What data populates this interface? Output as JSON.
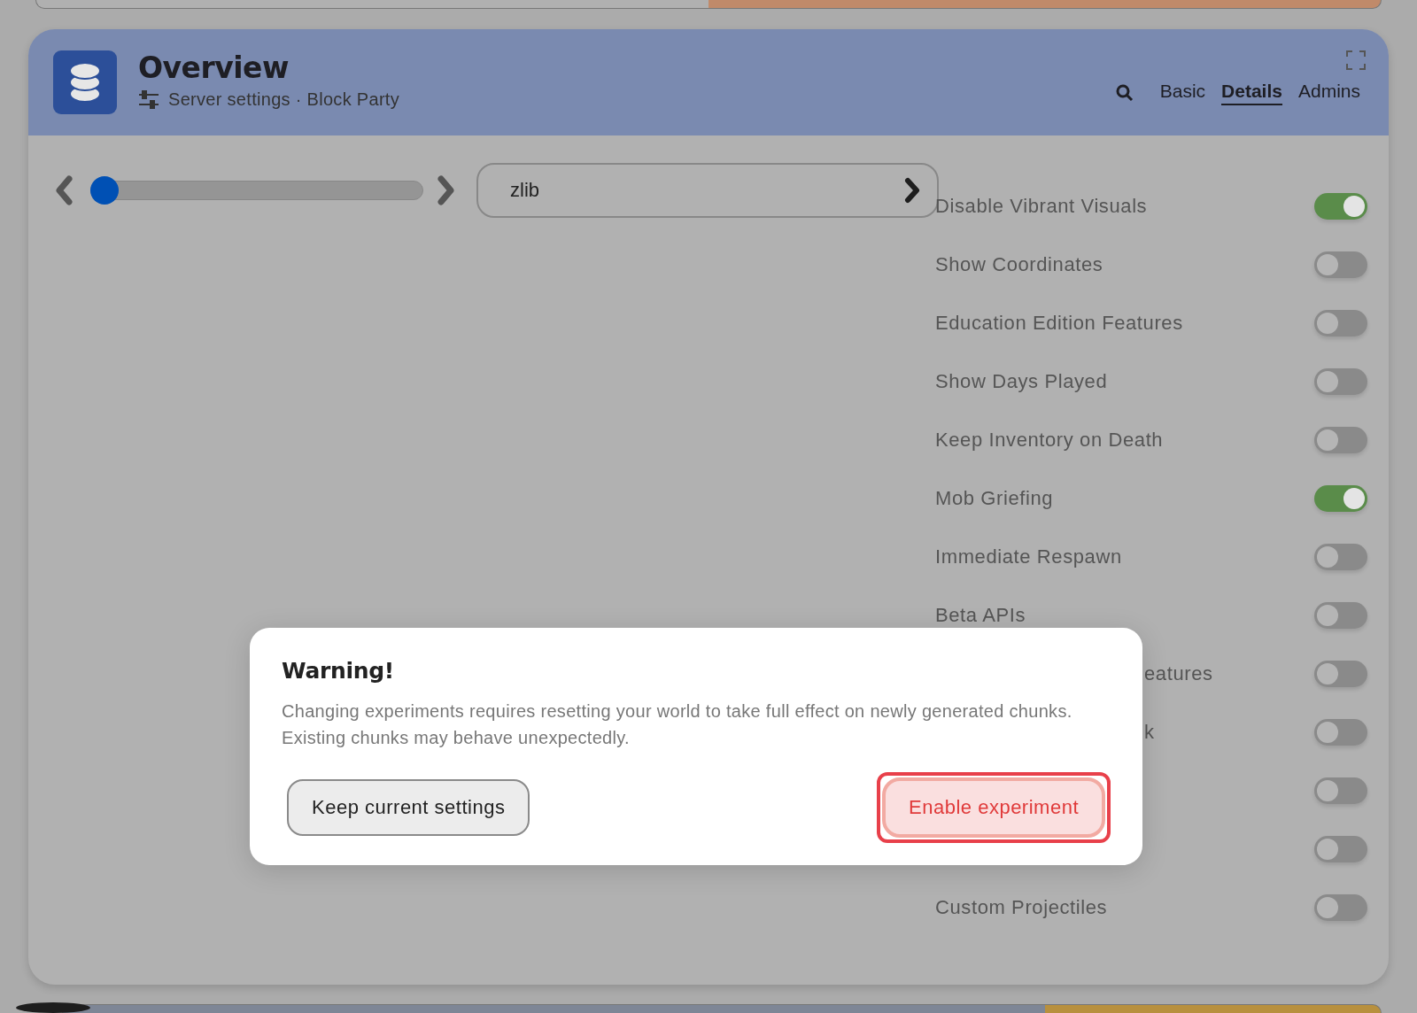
{
  "header": {
    "title": "Overview",
    "subtitle": "Server settings · Block Party",
    "tabs": [
      {
        "label": "Basic",
        "selected": false
      },
      {
        "label": "Details",
        "selected": true
      },
      {
        "label": "Admins",
        "selected": false
      }
    ]
  },
  "pager": {
    "level": 0,
    "value": "zlib"
  },
  "settings": [
    {
      "label": "Disable Vibrant Visuals",
      "on": true,
      "kind": "full"
    },
    {
      "label": "Show Coordinates",
      "on": false,
      "kind": "full"
    },
    {
      "label": "Education Edition Features",
      "on": false,
      "kind": "full"
    },
    {
      "label": "Show Days Played",
      "on": false,
      "kind": "full"
    },
    {
      "label": "Keep Inventory on Death",
      "on": false,
      "kind": "full"
    },
    {
      "label": "Mob Griefing",
      "on": true,
      "kind": "full"
    },
    {
      "label": "Immediate Respawn",
      "on": false,
      "kind": "full"
    },
    {
      "label": "Beta APIs",
      "on": false,
      "kind": "full"
    },
    {
      "label": "eatures",
      "on": false,
      "kind": "partial"
    },
    {
      "label": "k",
      "on": false,
      "kind": "partial"
    },
    {
      "on": false,
      "kind": "hidden"
    },
    {
      "on": false,
      "kind": "hidden"
    },
    {
      "label": "Custom Projectiles",
      "on": false,
      "kind": "full"
    }
  ],
  "dialog": {
    "title": "Warning!",
    "message": "Changing experiments requires resetting your world to take full effect on newly generated chunks. Existing chunks may behave unexpectedly.",
    "buttons": [
      {
        "label": "Keep current settings",
        "kind": "secondary",
        "focused": false
      },
      {
        "label": "Enable experiment",
        "kind": "primary",
        "focused": true
      }
    ]
  }
}
